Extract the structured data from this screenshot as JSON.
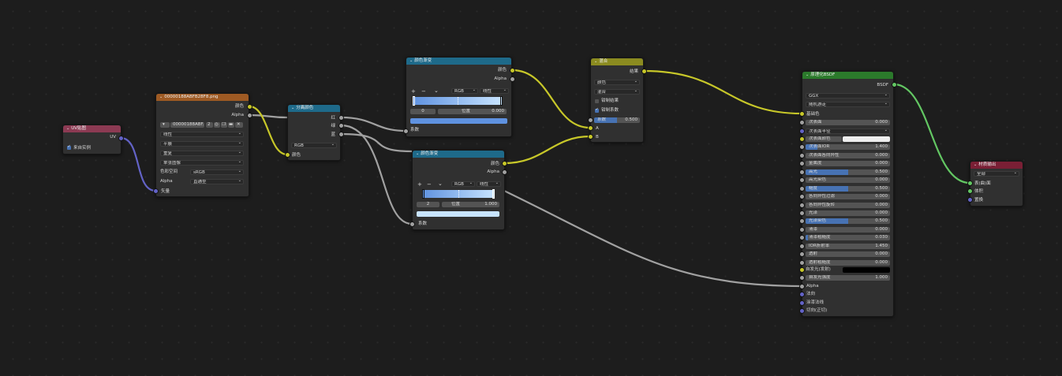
{
  "colors": {
    "vector_hdr": "#8c3a53",
    "texture_hdr": "#9e5a23",
    "converter_hdr": "#1e6a8a",
    "color_hdr": "#8b8b20",
    "shader_hdr": "#2b7a2b",
    "output_hdr": "#7a1f35",
    "color_socket": "#c7c729",
    "float_socket": "#a1a1a1",
    "vector_socket": "#6363c7",
    "shader_socket": "#63c763"
  },
  "uv_node": {
    "title": "UV贴图",
    "output": "UV",
    "from_instancer": "来自实例"
  },
  "image_node": {
    "title": "00000188ABFB28F8.png",
    "out_color": "颜色",
    "out_alpha": "Alpha",
    "image_name": "00000188ABF...",
    "users": "2",
    "interp": "线性",
    "projection": "平展",
    "extension": "重复",
    "source": "单张图像",
    "colorspace_label": "色彩空间",
    "colorspace": "sRGB",
    "alpha_label": "Alpha",
    "alpha": "直通型",
    "in_vector": "矢量"
  },
  "separate_node": {
    "title": "分离颜色",
    "out_r": "红",
    "out_g": "绿",
    "out_b": "蓝",
    "mode": "RGB",
    "in_color": "颜色"
  },
  "ramp1": {
    "title": "颜色渐变",
    "out_color": "颜色",
    "out_alpha": "Alpha",
    "plus": "+",
    "minus": "−",
    "mode": "RGB",
    "interp": "线性",
    "index": "0",
    "pos_label": "位置",
    "pos": "0.000",
    "in_fac": "系数"
  },
  "ramp2": {
    "title": "颜色渐变",
    "out_color": "颜色",
    "out_alpha": "Alpha",
    "plus": "+",
    "minus": "−",
    "mode": "RGB",
    "interp": "线性",
    "index": "2",
    "pos_label": "位置",
    "pos": "1.000",
    "in_fac": "系数"
  },
  "mix_node": {
    "title": "混合",
    "out_result": "结果",
    "type": "颜色",
    "blend": "混合",
    "clamp_result": "钳制结果",
    "clamp_factor": "钳制系数",
    "fac_label": "系数",
    "fac": "0.500",
    "fac_value": 0.5,
    "in_a": "A",
    "in_b": "B"
  },
  "bsdf_node": {
    "title": "原理化BSDF",
    "out_bsdf": "BSDF",
    "distribution": "GGX",
    "sss_method": "随机游走",
    "in_base": "基础色",
    "emission": "自发光(发射)",
    "alpha": "Alpha",
    "normal": "法向",
    "clearcoat_normal": "涂漆法线",
    "tangent": "切向(正切)",
    "rows": [
      {
        "name": "次表面",
        "value": "0.000",
        "fill": 0
      },
      {
        "name": "次表面半径",
        "value": "",
        "fill": 0,
        "dd": true
      },
      {
        "name": "次表面颜色",
        "value": "",
        "fill": 0,
        "swatch": "#eeeeee"
      },
      {
        "name": "次表面IOR",
        "value": "1.400",
        "fill": 0.14
      },
      {
        "name": "次表面各向异性",
        "value": "0.000",
        "fill": 0
      },
      {
        "name": "金属度",
        "value": "0.000",
        "fill": 0
      },
      {
        "name": "高光",
        "value": "0.500",
        "fill": 0.5
      },
      {
        "name": "高光染色",
        "value": "0.000",
        "fill": 0
      },
      {
        "name": "糙度",
        "value": "0.500",
        "fill": 0.5
      },
      {
        "name": "各向异性过滤",
        "value": "0.000",
        "fill": 0
      },
      {
        "name": "各向异性旋转",
        "value": "0.000",
        "fill": 0
      },
      {
        "name": "光泽",
        "value": "0.000",
        "fill": 0
      },
      {
        "name": "光泽染色",
        "value": "0.500",
        "fill": 0.5
      },
      {
        "name": "清漆",
        "value": "0.000",
        "fill": 0
      },
      {
        "name": "清漆粗糙度",
        "value": "0.030",
        "fill": 0.03
      },
      {
        "name": "IOR折射率",
        "value": "1.450",
        "fill": 0
      },
      {
        "name": "透射",
        "value": "0.000",
        "fill": 0
      },
      {
        "name": "透射粗糙度",
        "value": "0.000",
        "fill": 0
      }
    ],
    "emission_strength_label": "自发光强度",
    "emission_strength": "1.000"
  },
  "output_node": {
    "title": "材质输出",
    "target": "全部",
    "in_surface": "表(曲)面",
    "in_volume": "体积",
    "in_displacement": "置换"
  }
}
